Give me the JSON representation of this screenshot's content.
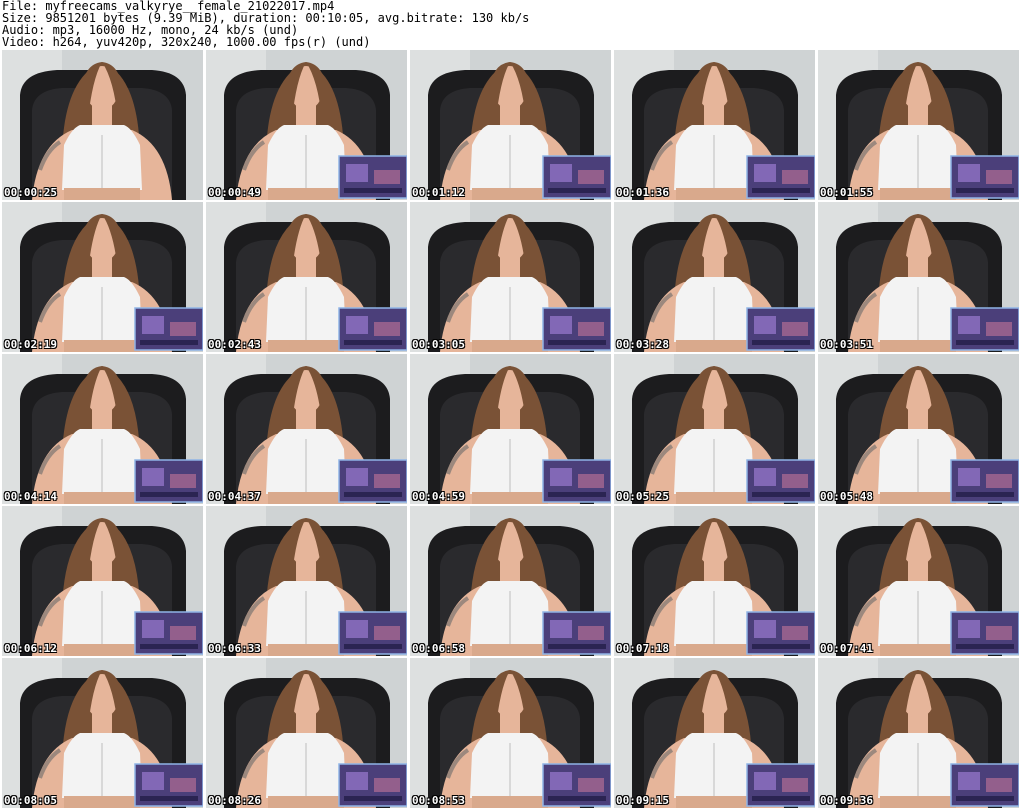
{
  "header": {
    "file_line": "File: myfreecams_valkyrye__female_21022017.mp4",
    "size_line": "Size: 9851201 bytes (9.39 MiB), duration: 00:10:05, avg.bitrate: 130 kb/s",
    "audio_line": "Audio: mp3, 16000 Hz, mono, 24 kb/s (und)",
    "video_line": "Video: h264, yuv420p, 320x240, 1000.00 fps(r) (und)"
  },
  "colors": {
    "wall": "#cfd3d4",
    "chair": "#1c1c1e",
    "skin": "#e6b59a",
    "hair": "#7a5236",
    "top": "#f3f3f3",
    "game_panel": "#4b3f7a"
  },
  "thumbnails": [
    {
      "timestamp": "00:00:25",
      "game_overlay": false
    },
    {
      "timestamp": "00:00:49",
      "game_overlay": true
    },
    {
      "timestamp": "00:01:12",
      "game_overlay": true
    },
    {
      "timestamp": "00:01:36",
      "game_overlay": true
    },
    {
      "timestamp": "00:01:55",
      "game_overlay": true
    },
    {
      "timestamp": "00:02:19",
      "game_overlay": true
    },
    {
      "timestamp": "00:02:43",
      "game_overlay": true
    },
    {
      "timestamp": "00:03:05",
      "game_overlay": true
    },
    {
      "timestamp": "00:03:28",
      "game_overlay": true
    },
    {
      "timestamp": "00:03:51",
      "game_overlay": true
    },
    {
      "timestamp": "00:04:14",
      "game_overlay": true
    },
    {
      "timestamp": "00:04:37",
      "game_overlay": true
    },
    {
      "timestamp": "00:04:59",
      "game_overlay": true
    },
    {
      "timestamp": "00:05:25",
      "game_overlay": true
    },
    {
      "timestamp": "00:05:48",
      "game_overlay": true
    },
    {
      "timestamp": "00:06:12",
      "game_overlay": true
    },
    {
      "timestamp": "00:06:33",
      "game_overlay": true
    },
    {
      "timestamp": "00:06:58",
      "game_overlay": true
    },
    {
      "timestamp": "00:07:18",
      "game_overlay": true
    },
    {
      "timestamp": "00:07:41",
      "game_overlay": true
    },
    {
      "timestamp": "00:08:05",
      "game_overlay": true
    },
    {
      "timestamp": "00:08:26",
      "game_overlay": true
    },
    {
      "timestamp": "00:08:53",
      "game_overlay": true
    },
    {
      "timestamp": "00:09:15",
      "game_overlay": true
    },
    {
      "timestamp": "00:09:36",
      "game_overlay": true
    }
  ]
}
